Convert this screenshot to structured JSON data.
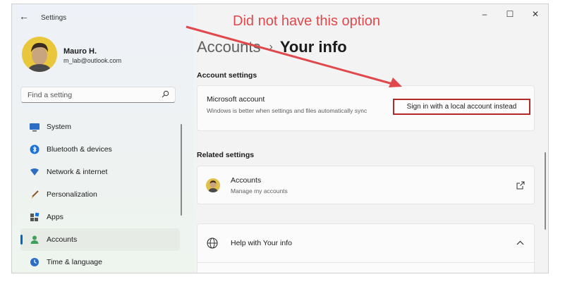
{
  "window": {
    "title": "Settings",
    "back_glyph": "←",
    "controls": {
      "minimize": "–",
      "maximize": "☐",
      "close": "✕"
    }
  },
  "user": {
    "name": "Mauro H.",
    "email": "m_lab@outlook.com"
  },
  "search": {
    "placeholder": "Find a setting"
  },
  "nav": [
    {
      "label": "System",
      "icon": "monitor-icon",
      "active": false
    },
    {
      "label": "Bluetooth & devices",
      "icon": "bluetooth-icon",
      "active": false
    },
    {
      "label": "Network & internet",
      "icon": "wifi-icon",
      "active": false
    },
    {
      "label": "Personalization",
      "icon": "brush-icon",
      "active": false
    },
    {
      "label": "Apps",
      "icon": "apps-icon",
      "active": false
    },
    {
      "label": "Accounts",
      "icon": "person-icon",
      "active": true
    },
    {
      "label": "Time & language",
      "icon": "globe-clock-icon",
      "active": false
    }
  ],
  "breadcrumb": {
    "parent": "Accounts",
    "separator": "›",
    "current": "Your info"
  },
  "account_settings": {
    "title": "Account settings",
    "microsoft": {
      "title": "Microsoft account",
      "description": "Windows is better when settings and files automatically sync",
      "button": "Sign in with a local account instead"
    }
  },
  "related_settings": {
    "title": "Related settings",
    "accounts": {
      "title": "Accounts",
      "subtitle": "Manage my accounts"
    }
  },
  "help": {
    "title": "Help with Your info"
  },
  "annotation": {
    "text": "Did not have this option",
    "color": "#e0484b"
  },
  "colors": {
    "accent": "#0067c0",
    "highlight_box": "#b02a2a"
  }
}
